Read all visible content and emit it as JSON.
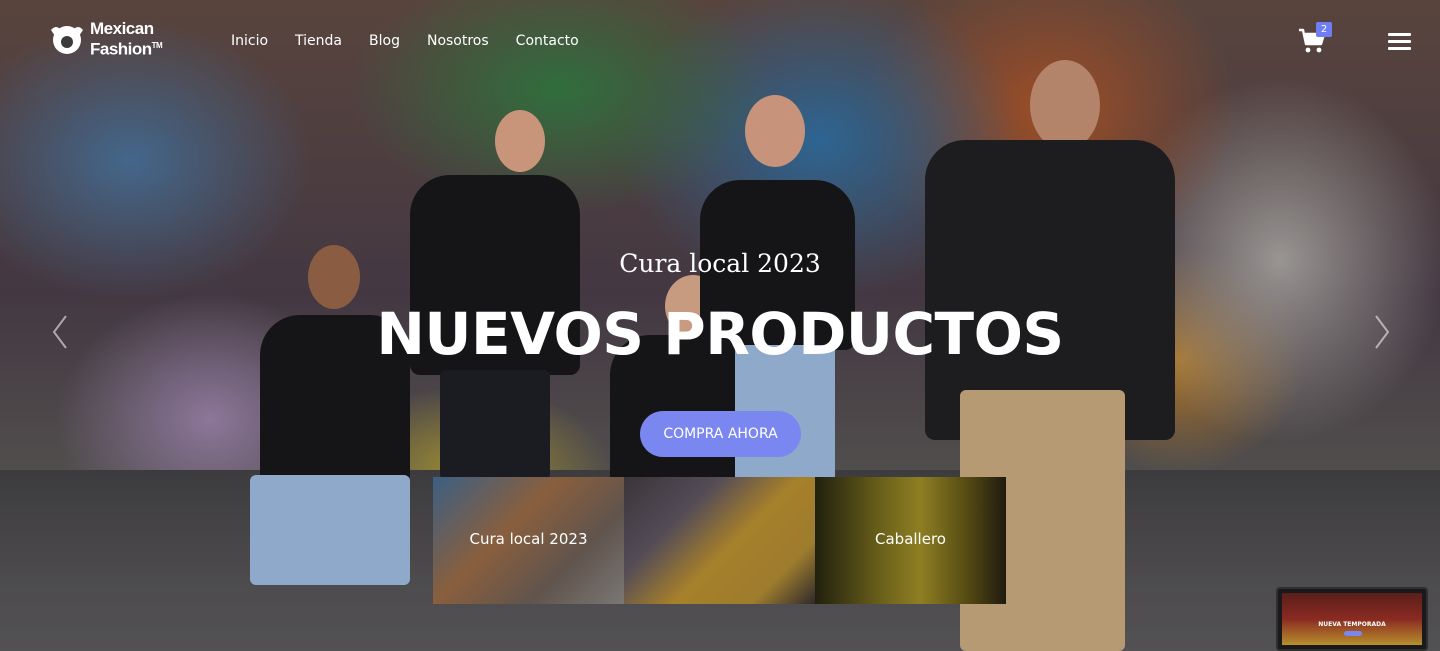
{
  "brand": {
    "line1": "Mexican",
    "line2": "Fashion",
    "tm": "TM"
  },
  "nav": {
    "items": [
      {
        "label": "Inicio"
      },
      {
        "label": "Tienda"
      },
      {
        "label": "Blog"
      },
      {
        "label": "Nosotros"
      },
      {
        "label": "Contacto"
      }
    ],
    "cart_icon": "shopping-cart-icon",
    "cart_count": "2",
    "menu_icon": "hamburger-menu-icon"
  },
  "hero": {
    "subtitle": "Cura local 2023",
    "title": "NUEVOS PRODUCTOS",
    "cta_label": "COMPRA AHORA",
    "prev_icon": "chevron-left-icon",
    "next_icon": "chevron-right-icon"
  },
  "categories": [
    {
      "label": "Cura local 2023"
    },
    {
      "label": ""
    },
    {
      "label": "Caballero"
    }
  ],
  "preview": {
    "label": "NUEVA TEMPORADA"
  },
  "colors": {
    "accent": "#7b87f0",
    "badge": "#6f7ef2",
    "text": "#ffffff"
  }
}
